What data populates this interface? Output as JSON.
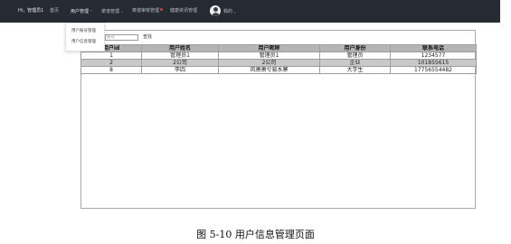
{
  "nav": {
    "greeting": "Hi，管理员1",
    "home": "首页",
    "user_mgmt": "用户管理",
    "category_mgmt": "菜谱管理",
    "recipe_review": "菜谱审核管理",
    "feedback_mgmt": "健康资讯管理",
    "mine": "我的",
    "caret": "⌃",
    "caret_down": "⌄"
  },
  "dropdown": {
    "items": [
      "用户账号管理",
      "用户信息管理"
    ]
  },
  "search": {
    "placeholder": "查找",
    "value": "账号",
    "button_label": "查找"
  },
  "table": {
    "headers": [
      "用户id",
      "用户姓名",
      "用户昵称",
      "用户身份",
      "联系电话"
    ],
    "rows": [
      [
        "1",
        "管理员1",
        "管理员1",
        "管理员",
        "1234577"
      ],
      [
        "2",
        "2公司",
        "2公司",
        "企业",
        "101855615"
      ],
      [
        "8",
        "李四",
        "风萧萧兮易水寒",
        "大学生",
        "17756554482"
      ]
    ]
  },
  "caption": "图 5-10 用户信息管理页面",
  "colors": {
    "nav_bg": "#262b33",
    "header_bg": "#b5b5b5",
    "alt_row_bg": "#c9c9c9",
    "badge_dot": "#e4393c"
  }
}
